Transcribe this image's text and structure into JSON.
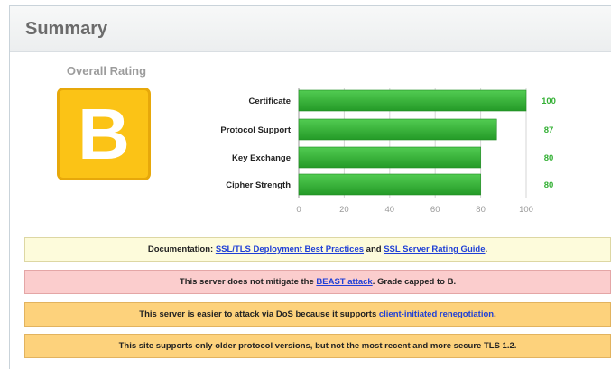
{
  "summary": {
    "title": "Summary",
    "overall_label": "Overall Rating",
    "grade": "B"
  },
  "chart_data": {
    "type": "bar",
    "orientation": "horizontal",
    "categories": [
      "Certificate",
      "Protocol Support",
      "Key Exchange",
      "Cipher Strength"
    ],
    "values": [
      100,
      87,
      80,
      80
    ],
    "value_labels": [
      "100",
      "87",
      "80",
      "80"
    ],
    "xlim": [
      0,
      100
    ],
    "xticks": [
      "0",
      "20",
      "40",
      "60",
      "80",
      "100"
    ],
    "bar_color": "#34b035",
    "value_label_color": "#34b035",
    "grid": true
  },
  "notices": [
    {
      "color": "yellow",
      "segments": [
        {
          "text": "Documentation: "
        },
        {
          "text": "SSL/TLS Deployment Best Practices",
          "link": true
        },
        {
          "text": " and "
        },
        {
          "text": "SSL Server Rating Guide",
          "link": true
        },
        {
          "text": "."
        }
      ]
    },
    {
      "color": "red",
      "segments": [
        {
          "text": "This server does not mitigate the "
        },
        {
          "text": "BEAST attack",
          "link": true
        },
        {
          "text": ". Grade capped to B."
        }
      ]
    },
    {
      "color": "orange",
      "segments": [
        {
          "text": "This server is easier to attack via DoS because it supports "
        },
        {
          "text": "client-initiated renegotiation",
          "link": true
        },
        {
          "text": "."
        }
      ]
    },
    {
      "color": "orange",
      "segments": [
        {
          "text": "This site supports only older protocol versions, but not the most recent and more secure TLS 1.2."
        }
      ]
    }
  ]
}
